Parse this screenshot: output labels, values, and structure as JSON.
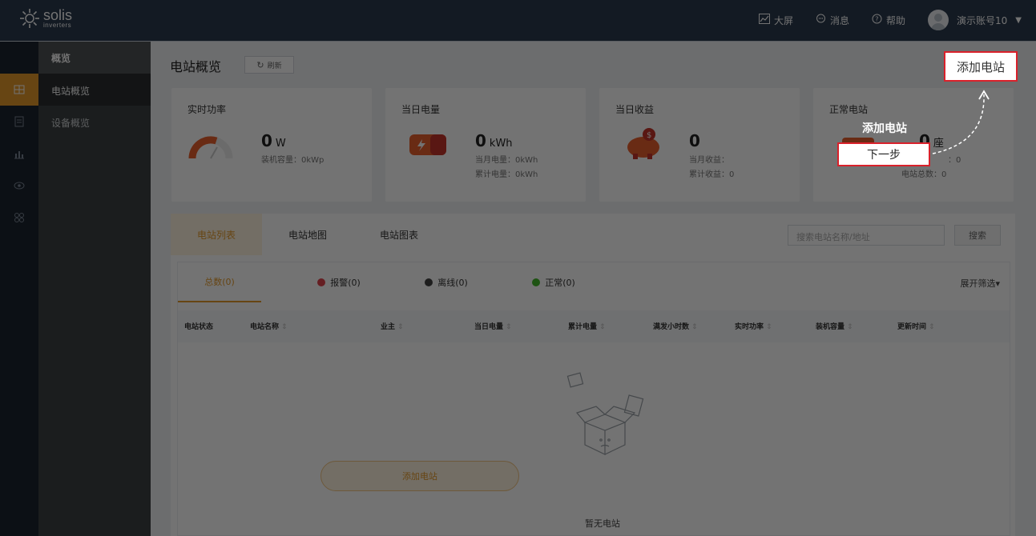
{
  "header": {
    "logo_text": "solis",
    "logo_subtext": "inverters",
    "nav": [
      {
        "icon": "chart-icon",
        "label": "大屏"
      },
      {
        "icon": "chat-icon",
        "label": "消息"
      },
      {
        "icon": "help-icon",
        "label": "帮助"
      }
    ],
    "user": "演示账号10"
  },
  "rail_icons": [
    "station-icon",
    "device-icon",
    "report-icon",
    "monitor-icon",
    "apps-icon"
  ],
  "sidebar": {
    "title": "概览",
    "items": [
      {
        "label": "电站概览",
        "active": true
      },
      {
        "label": "设备概览",
        "active": false
      }
    ]
  },
  "page": {
    "title": "电站概览",
    "refresh_label": "刷新",
    "add_station_label": "添加电站"
  },
  "cards": {
    "power": {
      "title": "实时功率",
      "value": "0",
      "unit": "W",
      "capacity": "装机容量：0kWp"
    },
    "energy": {
      "title": "当日电量",
      "value": "0",
      "unit": "kWh",
      "month": "当月电量：0kWh",
      "total": "累计电量：0kWh"
    },
    "income": {
      "title": "当日收益",
      "value": "0",
      "month": "当月收益：",
      "total": "累计收益：0"
    },
    "normal": {
      "title": "正常电站",
      "value": "0",
      "unit": "座",
      "ratio": "：0",
      "total": "电站总数：0"
    }
  },
  "tabs": [
    "电站列表",
    "电站地图",
    "电站图表"
  ],
  "search": {
    "placeholder": "搜索电站名称/地址",
    "button": "搜索"
  },
  "filters": {
    "total": "总数(0)",
    "alarm": "报警(0)",
    "offline": "离线(0)",
    "normal": "正常(0)",
    "expand": "展开筛选▾"
  },
  "status_colors": {
    "alarm": "#e0434d",
    "offline": "#444444",
    "normal": "#43b82b",
    "accent": "#e49a2c"
  },
  "table_columns": [
    "电站状态",
    "电站名称",
    "业主",
    "当日电量",
    "累计电量",
    "满发小时数",
    "实时功率",
    "装机容量",
    "更新时间"
  ],
  "empty": {
    "text": "暂无电站",
    "button": "添加电站"
  },
  "guide": {
    "title": "添加电站",
    "next": "下一步",
    "highlight": "添加电站"
  }
}
